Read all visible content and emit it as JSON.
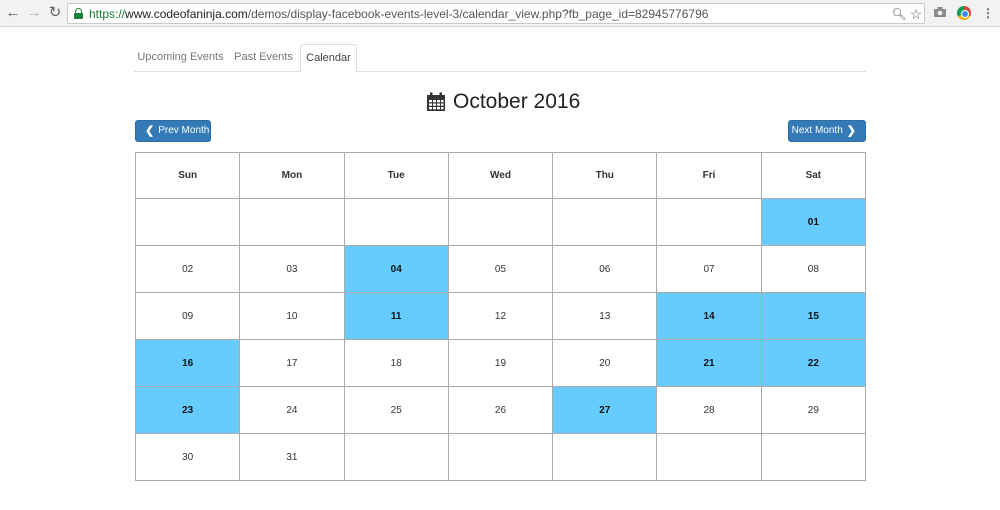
{
  "browser": {
    "url_scheme": "https://",
    "url_host": "www.codeofaninja.com",
    "url_path": "/demos/display-facebook-events-level-3/calendar_view.php?fb_page_id=82945776796",
    "icons": [
      "back-arrow-icon",
      "forward-arrow-icon",
      "reload-icon",
      "lock-icon",
      "zoom-icon",
      "star-icon",
      "camera-icon",
      "chrome-extension-icon",
      "menu-dots-icon"
    ]
  },
  "tabs": [
    {
      "label": "Upcoming Events",
      "active": false
    },
    {
      "label": "Past Events",
      "active": false
    },
    {
      "label": "Calendar",
      "active": true
    }
  ],
  "calendar": {
    "title": "October 2016",
    "title_icon": "calendar-icon",
    "prev_label": "Prev Month",
    "next_label": "Next Month",
    "weekdays": [
      "Sun",
      "Mon",
      "Tue",
      "Wed",
      "Thu",
      "Fri",
      "Sat"
    ],
    "weeks": [
      [
        "",
        "",
        "",
        "",
        "",
        "",
        "01"
      ],
      [
        "02",
        "03",
        "04",
        "05",
        "06",
        "07",
        "08"
      ],
      [
        "09",
        "10",
        "11",
        "12",
        "13",
        "14",
        "15"
      ],
      [
        "16",
        "17",
        "18",
        "19",
        "20",
        "21",
        "22"
      ],
      [
        "23",
        "24",
        "25",
        "26",
        "27",
        "28",
        "29"
      ],
      [
        "30",
        "31",
        "",
        "",
        "",
        "",
        ""
      ]
    ],
    "event_days": [
      "01",
      "04",
      "11",
      "14",
      "15",
      "16",
      "21",
      "22",
      "23",
      "27"
    ],
    "event_color": "#66ccff",
    "button_color": "#337ab7"
  }
}
